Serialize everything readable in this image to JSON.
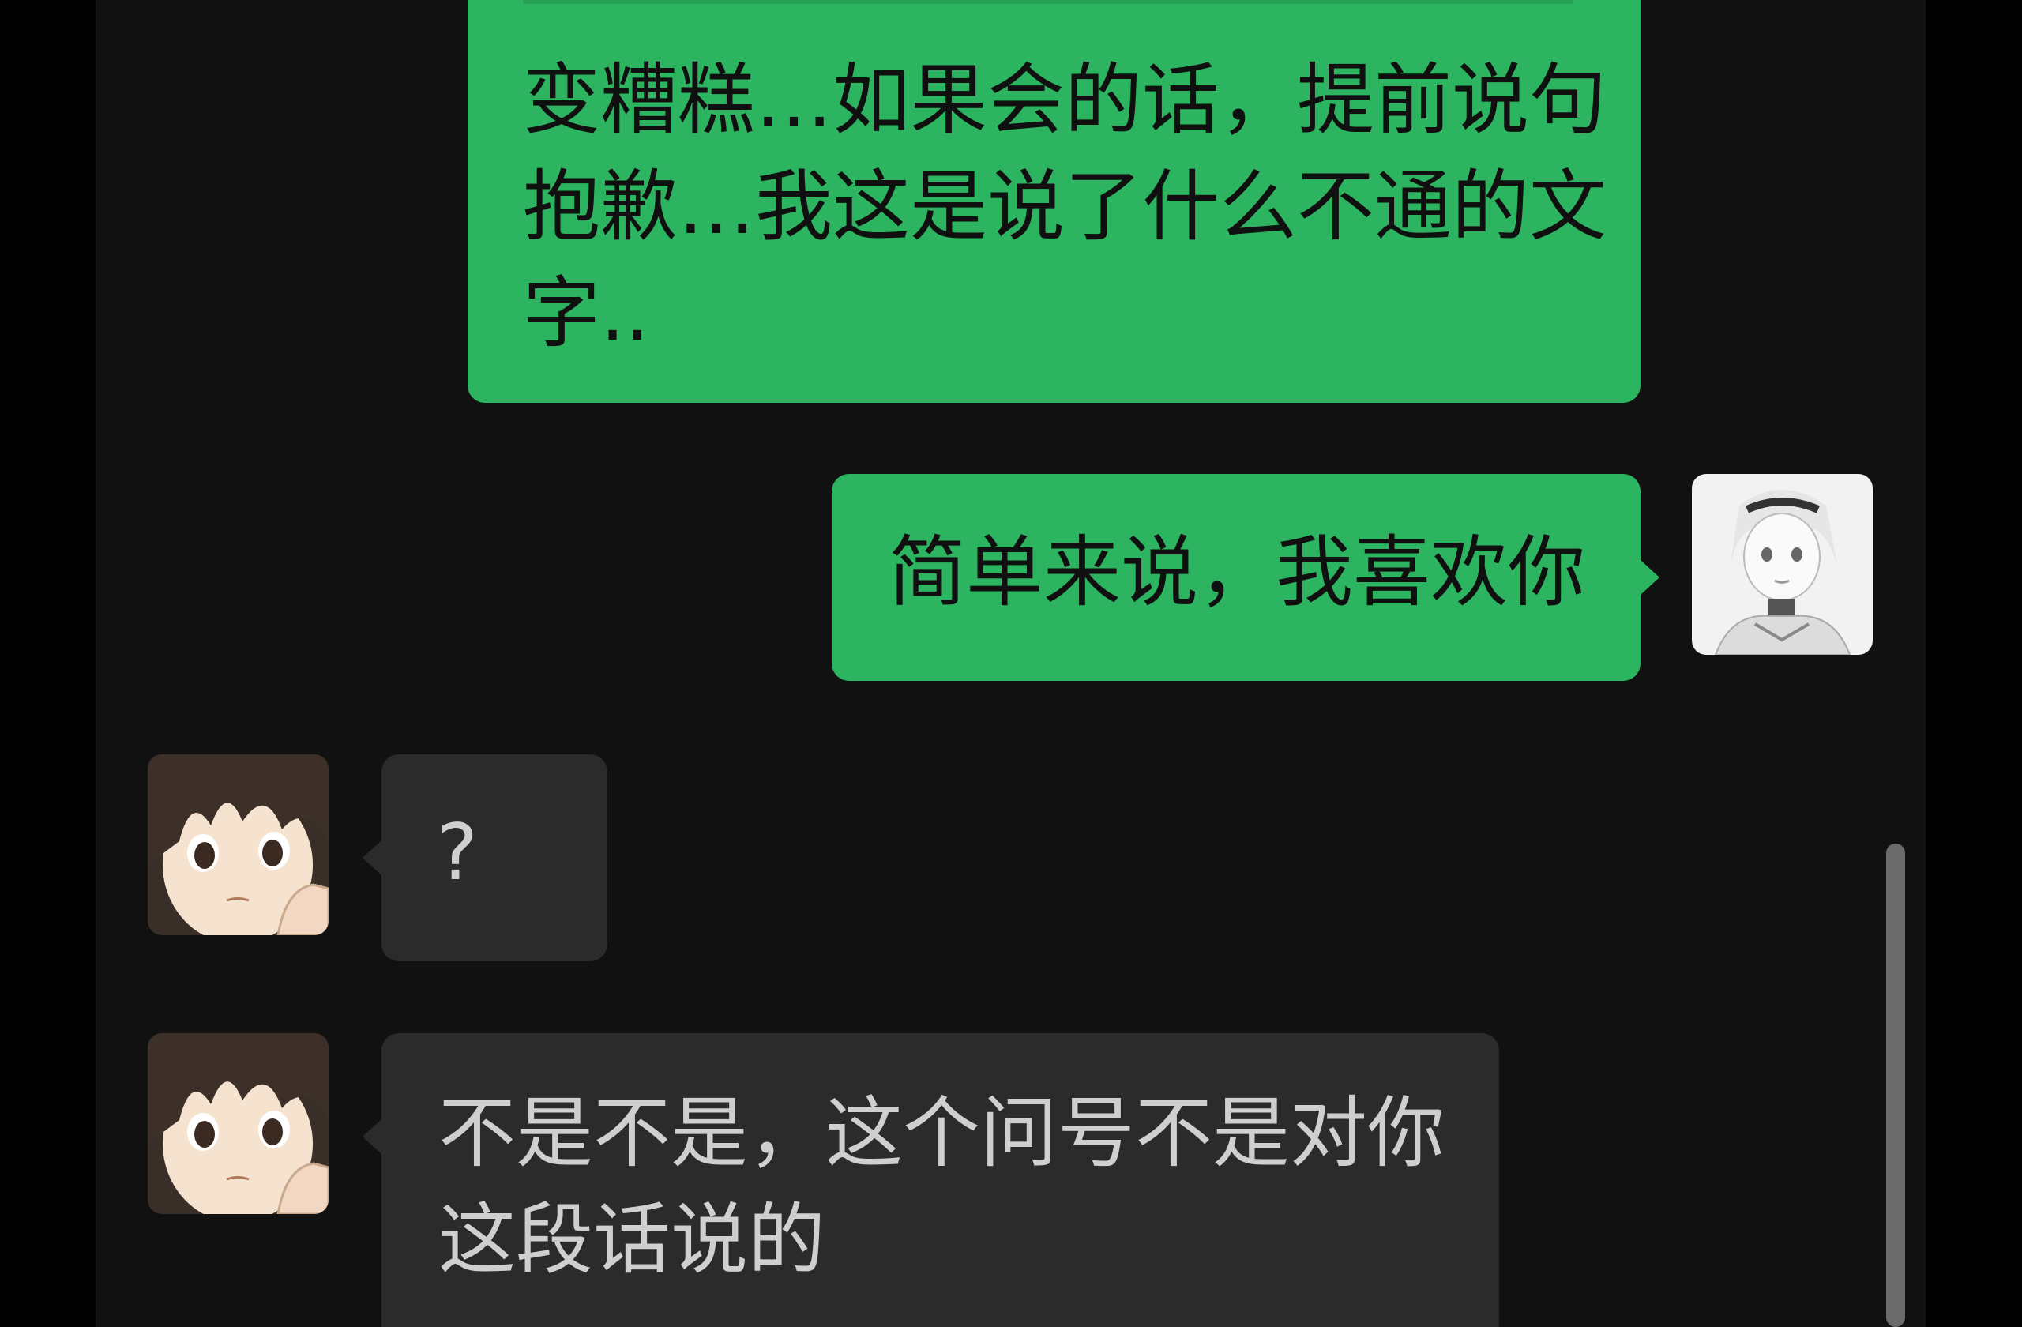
{
  "conversation": {
    "messages": [
      {
        "id": "m1",
        "direction": "outgoing",
        "lines": [
          "变糟糕…如果会的话，提前说句",
          "抱歉…我这是说了什么不通的文",
          "字.."
        ]
      },
      {
        "id": "m2",
        "direction": "outgoing",
        "lines": [
          "简单来说，我喜欢你"
        ],
        "avatar_icon": "grayscale-anime-girl-avatar-icon"
      },
      {
        "id": "m3",
        "direction": "incoming",
        "lines": [
          "?"
        ],
        "avatar_icon": "anime-boy-avatar-icon"
      },
      {
        "id": "m4",
        "direction": "incoming",
        "lines": [
          "不是不是，这个问号不是对你",
          "这段话说的"
        ],
        "avatar_icon": "anime-boy-avatar-icon"
      }
    ]
  },
  "colors": {
    "page_background": "#000000",
    "chat_background": "#111111",
    "outgoing_bubble": "#2db460",
    "incoming_bubble": "#2b2b2b",
    "incoming_text": "#cfcfcf",
    "outgoing_text": "#101010"
  }
}
